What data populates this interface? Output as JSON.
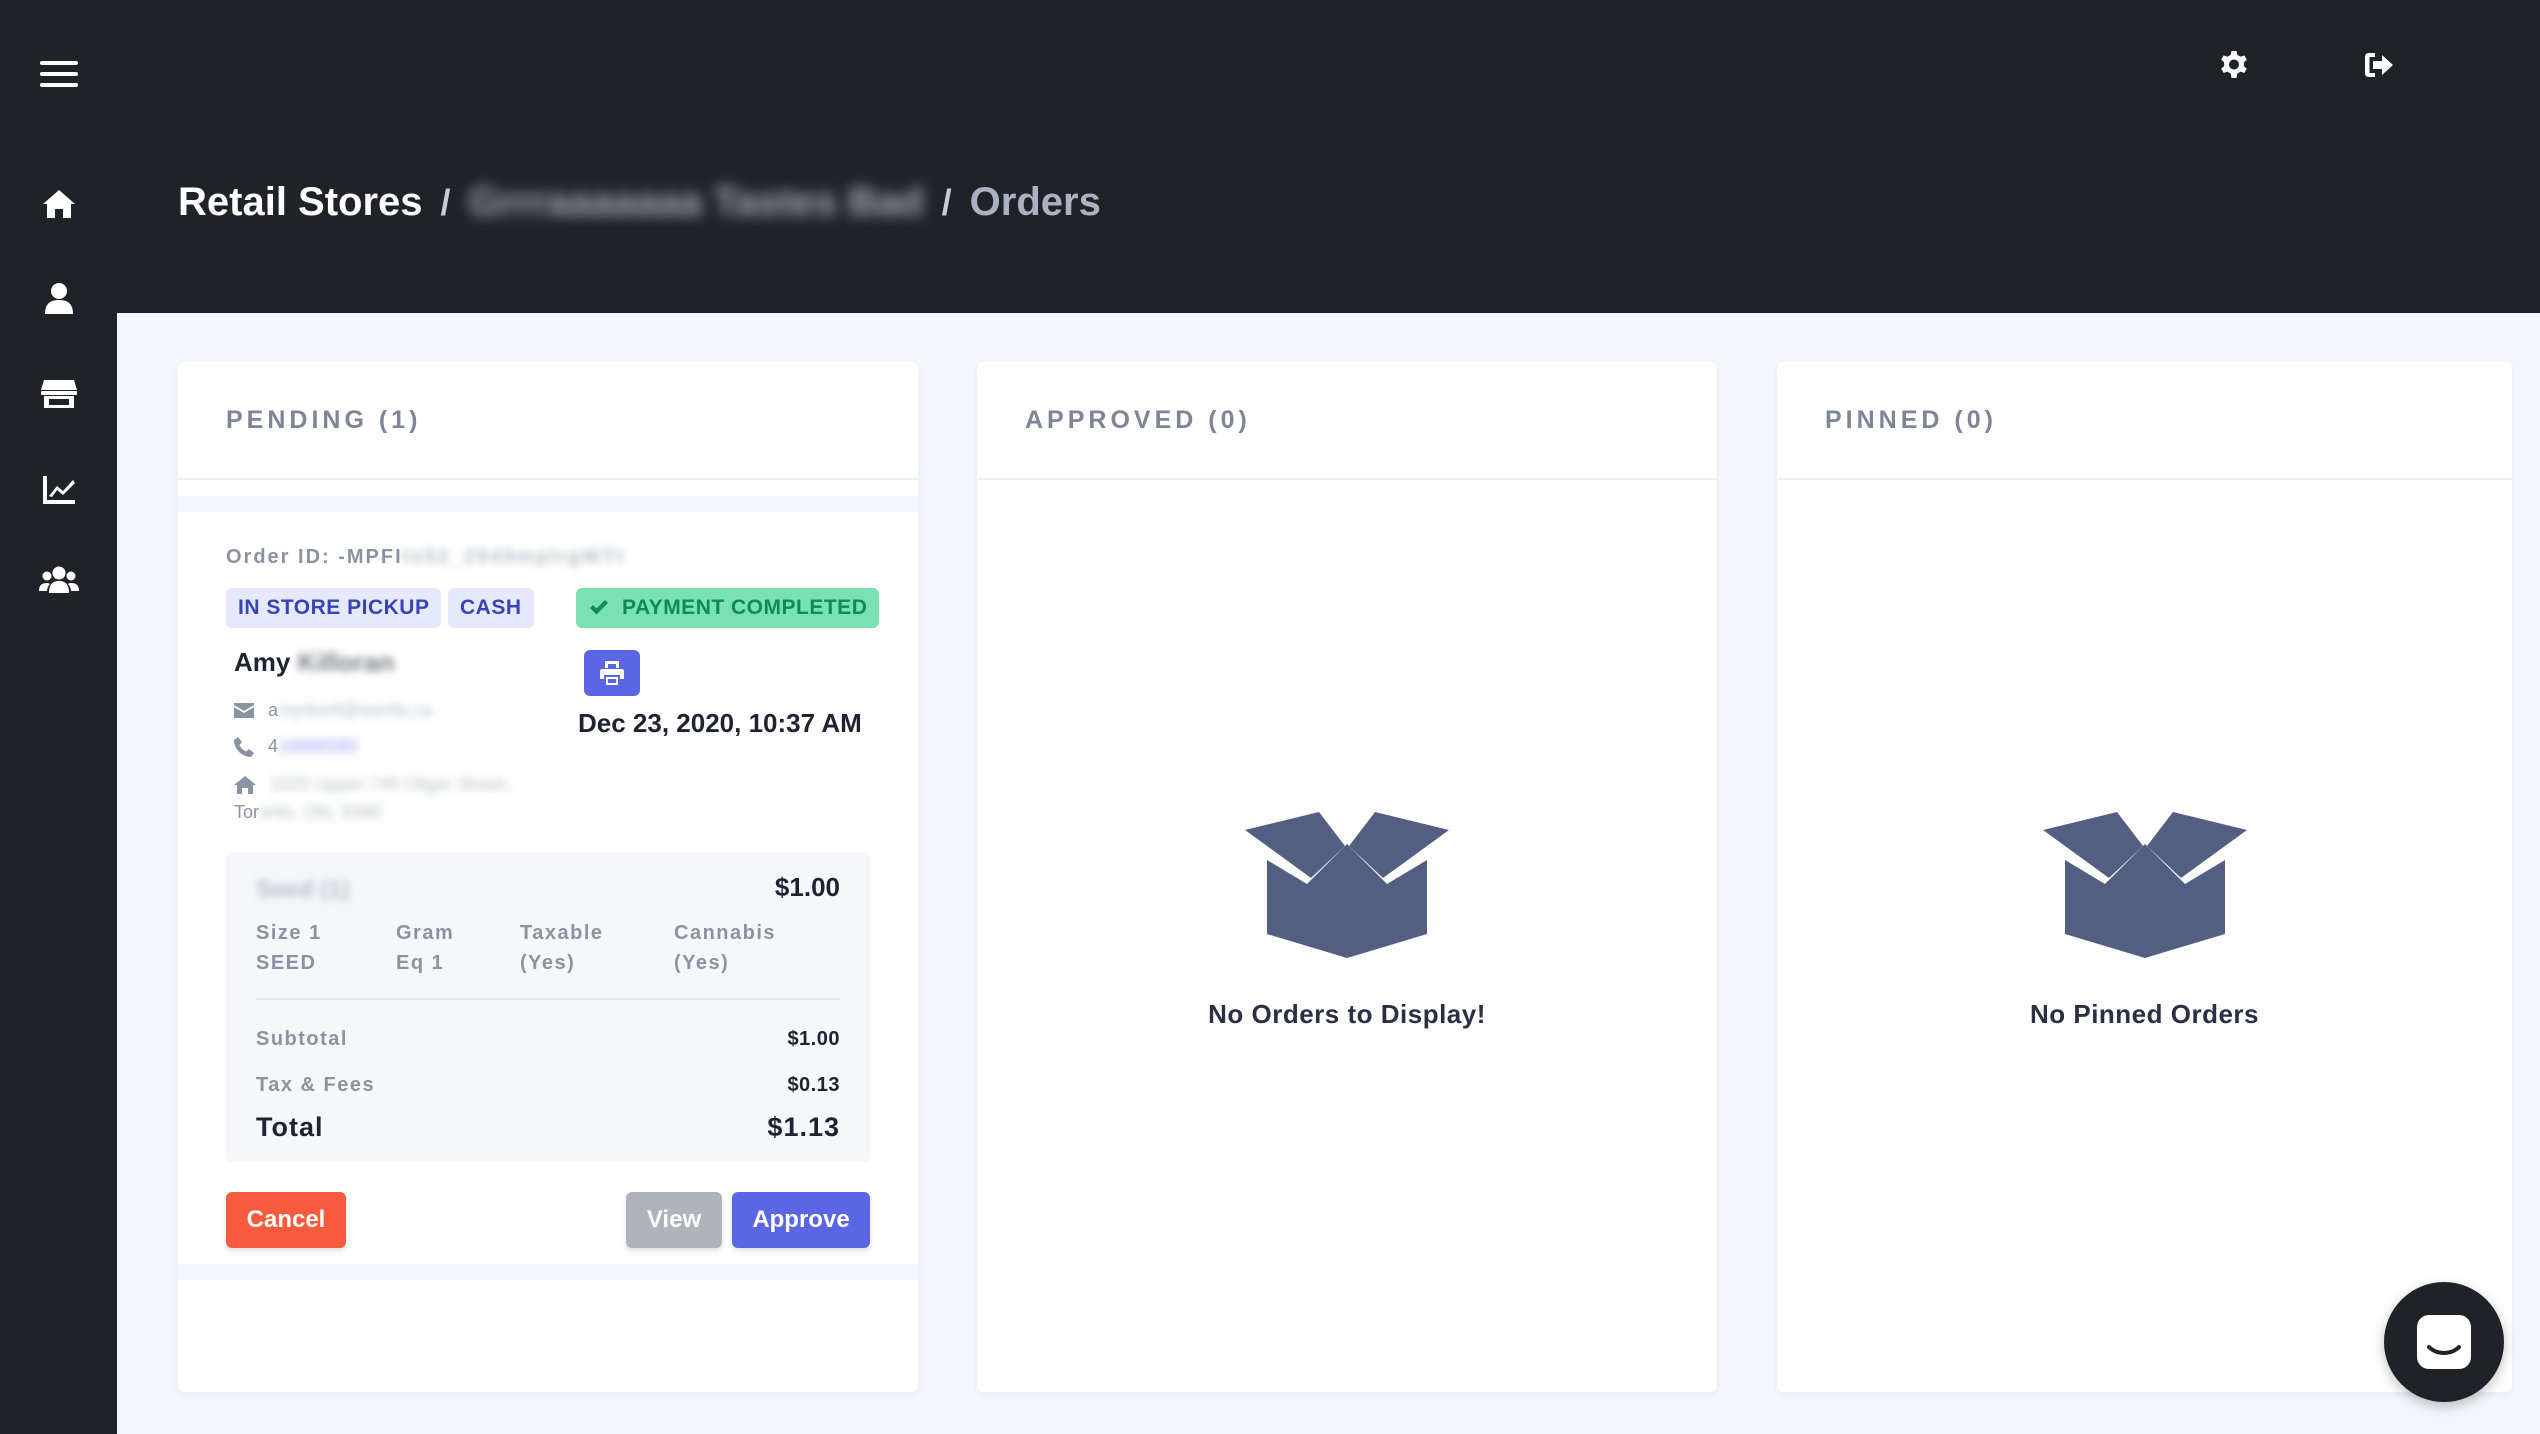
{
  "sidebar": {
    "icons": [
      "menu-icon",
      "home-icon",
      "user-icon",
      "store-icon",
      "chart-icon",
      "users-icon"
    ]
  },
  "header": {
    "icons": [
      "gear-icon",
      "sign-out-icon"
    ],
    "breadcrumb": {
      "root": "Retail Stores",
      "separator": "/",
      "store": "Grrraaaaaaa Tastes Bad",
      "current": "Orders"
    }
  },
  "columns": {
    "pending": {
      "title": "PENDING (1)"
    },
    "approved": {
      "title": "APPROVED (0)",
      "empty_text": "No Orders to Display!"
    },
    "pinned": {
      "title": "PINNED (0)",
      "empty_text": "No Pinned Orders"
    }
  },
  "order": {
    "id_label": "Order ID: -MPFI",
    "id_hidden": "ts52_2949mplrgWTt",
    "badges": {
      "pickup": "IN STORE PICKUP",
      "payment_method": "CASH",
      "payment_status": "PAYMENT COMPLETED"
    },
    "customer": {
      "first_name": "Amy",
      "last_name_hidden": "Killoran",
      "email_visible": "a",
      "email_hidden": "myrkertl@wertla.ca",
      "phone_visible": "4",
      "phone_hidden": "16666580",
      "address_hidden": "1025 Upper 749 Oliger Street,",
      "city_visible": "Tor",
      "city_hidden": "onto, ON, 9390"
    },
    "date": "Dec 23, 2020, 10:37 AM",
    "item": {
      "name_hidden": "Seed (1)",
      "price": "$1.00",
      "size_line1": "Size 1",
      "size_line2": "SEED",
      "gram_line1": "Gram",
      "gram_line2": "Eq 1",
      "taxable_line1": "Taxable",
      "taxable_line2": "(Yes)",
      "cannabis_line1": "Cannabis",
      "cannabis_line2": "(Yes)"
    },
    "summary": {
      "subtotal_label": "Subtotal",
      "subtotal": "$1.00",
      "tax_label": "Tax & Fees",
      "tax": "$0.13",
      "total_label": "Total",
      "total": "$1.13"
    },
    "buttons": {
      "cancel": "Cancel",
      "view": "View",
      "approve": "Approve"
    }
  },
  "chat": {
    "icon": "chat-icon"
  },
  "colors": {
    "dark": "#1f2227",
    "primary": "#5a66e3",
    "danger": "#f55b3c",
    "success": "#7ae2b2",
    "box_icon": "#525f82"
  }
}
